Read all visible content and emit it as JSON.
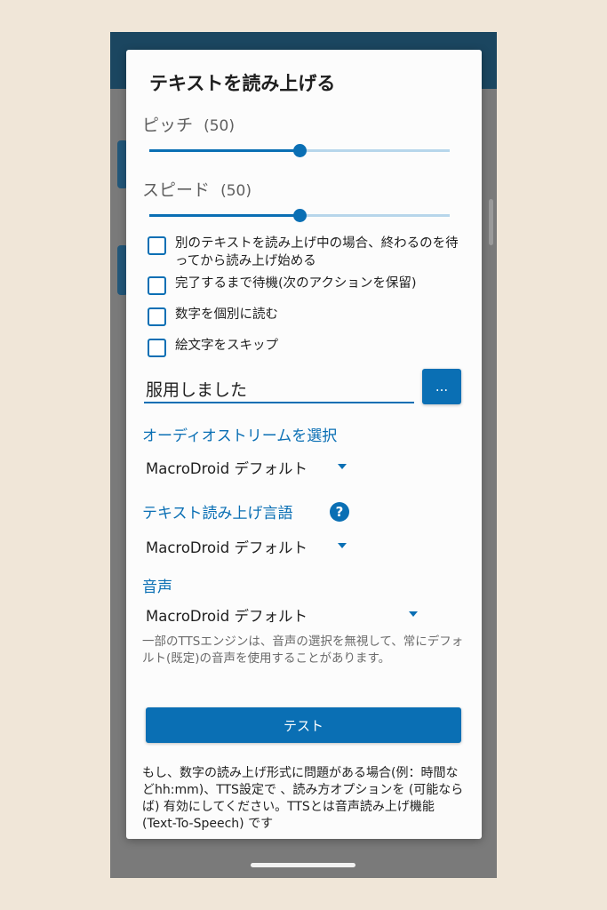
{
  "dialog": {
    "title": "テキストを読み上げる",
    "pitch": {
      "label": "ピッチ",
      "value_text": "(50)",
      "level": 0.5
    },
    "speed": {
      "label": "スピード",
      "value_text": "(50)",
      "level": 0.5
    },
    "checkboxes": [
      {
        "label": "別のテキストを読み上げ中の場合、終わるのを待ってから読み上げ始める",
        "checked": false
      },
      {
        "label": "完了するまで待機(次のアクションを保留)",
        "checked": false
      },
      {
        "label": "数字を個別に読む",
        "checked": false
      },
      {
        "label": "絵文字をスキップ",
        "checked": false
      }
    ],
    "text_input": {
      "value": "服用しました"
    },
    "dots_button": {
      "label": "..."
    },
    "audio_stream": {
      "label": "オーディオストリームを選択",
      "selected": "MacroDroid デフォルト"
    },
    "tts_language": {
      "label": "テキスト読み上げ言語",
      "help_icon": "?",
      "selected": "MacroDroid デフォルト"
    },
    "voice": {
      "label": "音声",
      "selected": "MacroDroid デフォルト"
    },
    "voice_note": "一部のTTSエンジンは、音声の選択を無視して、常にデフォルト(既定)の音声を使用することがあります。",
    "test_button": {
      "label": "テスト"
    },
    "footer": "もし、数字の読み上げ形式に問題がある場合(例：時間などhh:mm)、TTS設定で 、読み方オプションを (可能ならば) 有効にしてください。TTSとは音声読み上げ機能 (Text-To-Speech) です"
  },
  "colors": {
    "accent": "#0a6fb4",
    "app_bar": "#1b4660",
    "page_background": "#f0e6d8"
  }
}
